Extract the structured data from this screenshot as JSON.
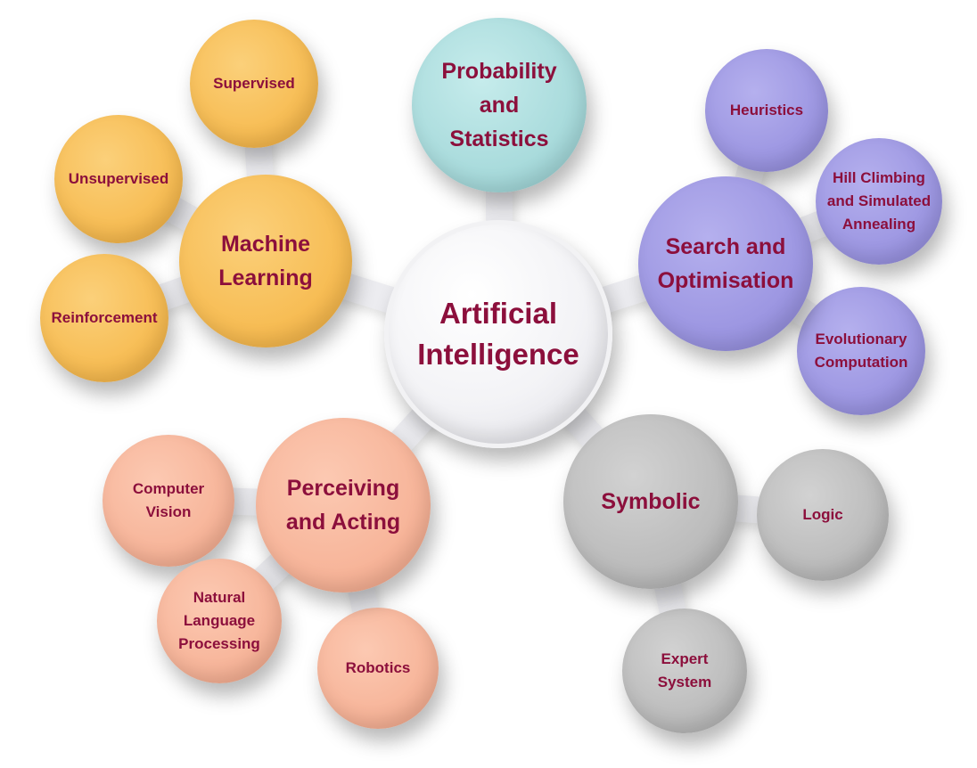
{
  "center": {
    "label": "Artificial\nIntelligence"
  },
  "groups": {
    "machine_learning": {
      "label": "Machine\nLearning",
      "color": "#f7bd55",
      "children": [
        "Supervised",
        "Unsupervised",
        "Reinforcement"
      ]
    },
    "probability": {
      "label": "Probability\nand\nStatistics",
      "color": "#a9dbdc"
    },
    "search": {
      "label": "Search and\nOptimisation",
      "color": "#9d97e2",
      "children": [
        "Heuristics",
        "Hill Climbing\nand Simulated\nAnnealing",
        "Evolutionary\nComputation"
      ]
    },
    "perceiving": {
      "label": "Perceiving\nand Acting",
      "color": "#f7b59a",
      "children": [
        "Computer\nVision",
        "Natural\nLanguage\nProcessing",
        "Robotics"
      ]
    },
    "symbolic": {
      "label": "Symbolic",
      "color": "#bcbcbc",
      "children": [
        "Logic",
        "Expert\nSystem"
      ]
    }
  },
  "text_color": "#8c0f3c",
  "connector_color": "#ececf0"
}
